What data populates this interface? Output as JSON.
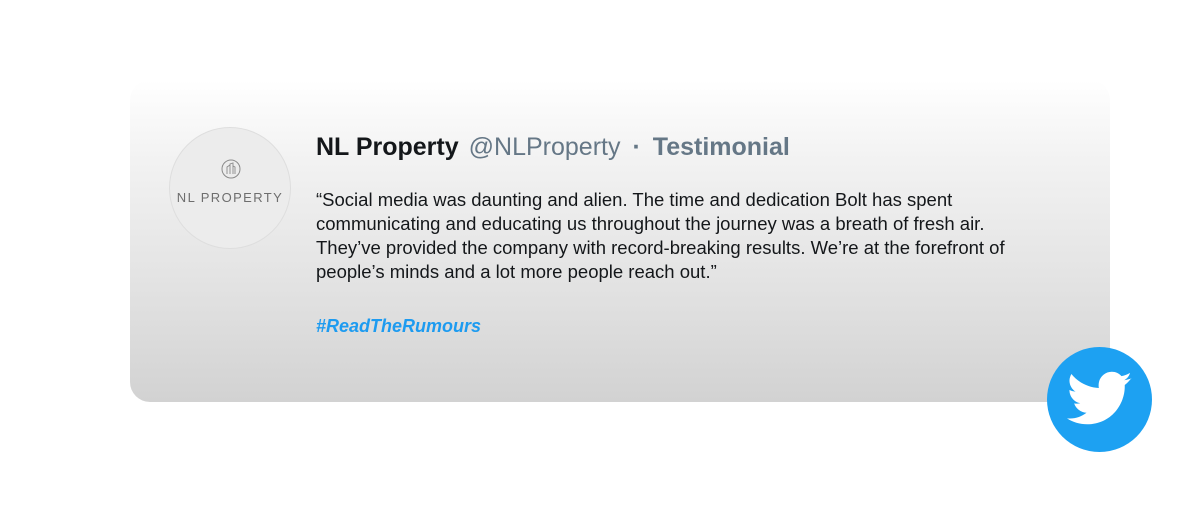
{
  "account": {
    "name": "NL Property",
    "handle": "@NLProperty",
    "separator": "·",
    "label": "Testimonial"
  },
  "avatar": {
    "logo_text": "NL PROPERTY",
    "icon": "building-logo-icon"
  },
  "testimonial": {
    "quote": "“Social media was daunting and alien. The time and dedication Bolt has spent communicating and educating us throughout the journey was a breath of fresh air. They’ve provided the company with record-breaking results. We’re at the forefront of people’s minds and a lot more people reach out.”",
    "hashtag": "#ReadTheRumours"
  },
  "badge": {
    "icon": "twitter-bird-icon"
  },
  "colors": {
    "accent": "#1da1f2",
    "hashtag": "#1d9bf0",
    "muted": "#657786",
    "text": "#14171a"
  }
}
